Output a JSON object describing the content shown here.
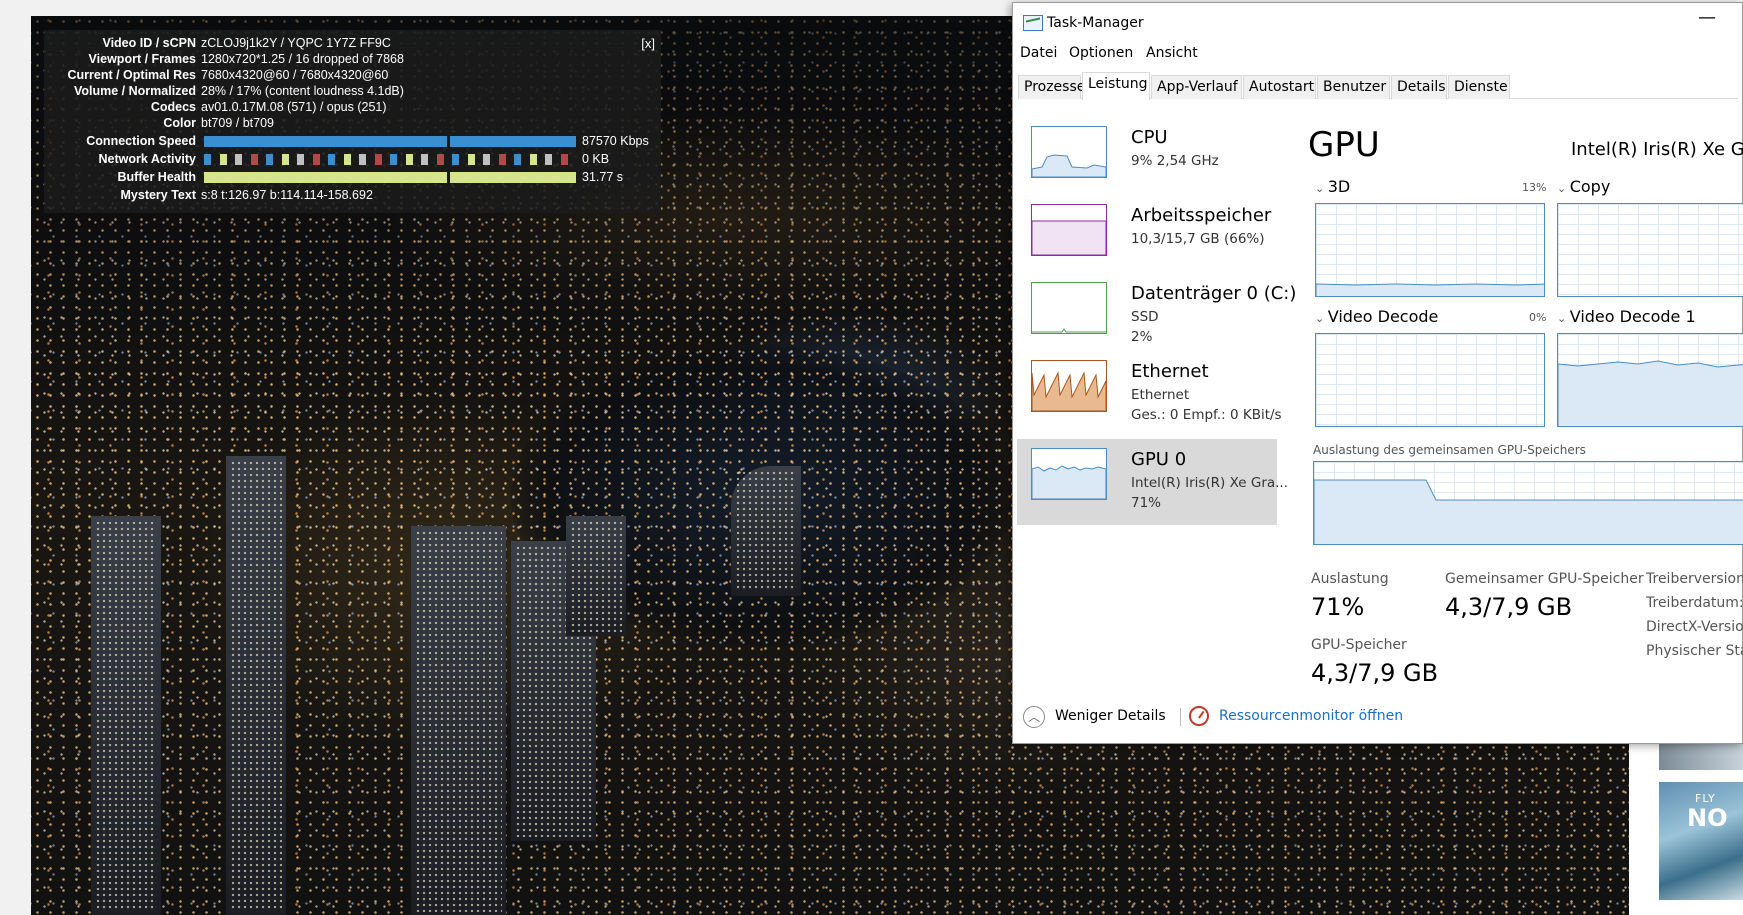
{
  "stats": {
    "close": "[x]",
    "rows": [
      {
        "label": "Video ID / sCPN",
        "value": "zCLOJ9j1k2Y / YQPC 1Y7Z FF9C"
      },
      {
        "label": "Viewport / Frames",
        "value": "1280x720*1.25 / 16 dropped of 7868"
      },
      {
        "label": "Current / Optimal Res",
        "value": "7680x4320@60 / 7680x4320@60"
      },
      {
        "label": "Volume / Normalized",
        "value": "28% / 17% (content loudness 4.1dB)"
      },
      {
        "label": "Codecs",
        "value": "av01.0.17M.08 (571) / opus (251)"
      },
      {
        "label": "Color",
        "value": "bt709 / bt709"
      }
    ],
    "connection_label": "Connection Speed",
    "connection_value": "87570 Kbps",
    "network_label": "Network Activity",
    "network_value": "0 KB",
    "buffer_label": "Buffer Health",
    "buffer_value": "31.77 s",
    "mystery_label": "Mystery Text",
    "mystery_value": "s:8 t:126.97 b:114.114-158.692",
    "colors": {
      "connection": "#3a8fd0",
      "buffer": "#d6e48a"
    }
  },
  "taskmanager": {
    "title": "Task-Manager",
    "minimize": "—",
    "menu": [
      "Datei",
      "Optionen",
      "Ansicht"
    ],
    "tabs": [
      "Prozesse",
      "Leistung",
      "App-Verlauf",
      "Autostart",
      "Benutzer",
      "Details",
      "Dienste"
    ],
    "active_tab": "Leistung",
    "resources": [
      {
        "name": "CPU",
        "sub1": "9%  2,54 GHz",
        "sub2": "",
        "color": "#4b8cc6"
      },
      {
        "name": "Arbeitsspeicher",
        "sub1": "10,3/15,7 GB (66%)",
        "sub2": "",
        "color": "#8b2c9e"
      },
      {
        "name": "Datenträger 0 (C:)",
        "sub1": "SSD",
        "sub2": "2%",
        "color": "#4da24a"
      },
      {
        "name": "Ethernet",
        "sub1": "Ethernet",
        "sub2": "Ges.: 0  Empf.: 0 KBit/s",
        "color": "#a7581f"
      },
      {
        "name": "GPU 0",
        "sub1": "Intel(R) Iris(R) Xe Gra...",
        "sub2": "71%",
        "color": "#4b8cc6"
      }
    ],
    "gpu": {
      "title": "GPU",
      "model": "Intel(R) Iris(R) Xe Gra",
      "engines": [
        {
          "label": "3D",
          "pct": "13%"
        },
        {
          "label": "Copy",
          "pct": ""
        },
        {
          "label": "Video Decode",
          "pct": "0%"
        },
        {
          "label": "Video Decode 1",
          "pct": ""
        }
      ],
      "shared_label": "Auslastung des gemeinsamen GPU-Speichers",
      "stats": [
        {
          "label": "Auslastung",
          "value": "71%"
        },
        {
          "label": "Gemeinsamer GPU-Speicher",
          "value": "4,3/7,9 GB"
        },
        {
          "label": "GPU-Speicher",
          "value": "4,3/7,9 GB"
        }
      ],
      "info": [
        "Treiberversion:",
        "Treiberdatum:",
        "DirectX-Version",
        "Physischer Star"
      ]
    },
    "footer": {
      "less": "Weniger Details",
      "resmon": "Ressourcenmonitor öffnen"
    }
  },
  "thumb_text": {
    "line1": "FLY",
    "line2": "NO"
  }
}
